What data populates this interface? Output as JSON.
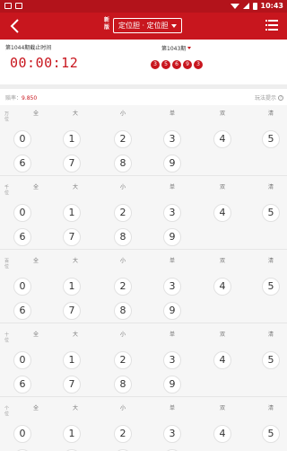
{
  "status_bar": {
    "time": "10:43",
    "icons": [
      "notification-icon",
      "notification-icon",
      "wifi-icon",
      "signal-icon",
      "battery-icon"
    ]
  },
  "nav": {
    "back_icon": "chevron-left-icon",
    "subtitle": "新版",
    "title": "定位胆 · 定位胆",
    "menu_icon": "menu-icon",
    "colors": {
      "bar": "#c8161e",
      "status": "#b3131b"
    }
  },
  "lottery": {
    "countdown_label": "第1044期截止时间",
    "countdown": "00:00:12",
    "last_issue": "第1043期",
    "last_result": [
      "3",
      "5",
      "6",
      "9",
      "3"
    ]
  },
  "bonus": {
    "label": "赔率：",
    "value": "9.850",
    "help_label": "玩法提示"
  },
  "options": [
    "全",
    "大",
    "小",
    "单",
    "双",
    "清"
  ],
  "digits": [
    "0",
    "1",
    "2",
    "3",
    "4",
    "5",
    "6",
    "7",
    "8",
    "9"
  ],
  "positions": [
    {
      "label": "万位"
    },
    {
      "label": "千位"
    },
    {
      "label": "百位"
    },
    {
      "label": "十位"
    },
    {
      "label": "个位"
    }
  ]
}
